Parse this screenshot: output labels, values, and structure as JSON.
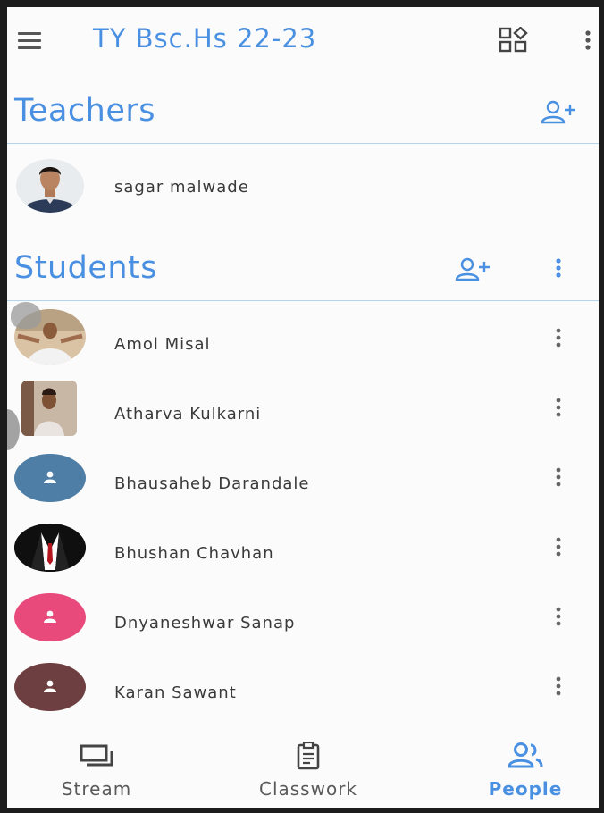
{
  "app_bar": {
    "class_name": "TY Bsc.Hs 22-23",
    "menu_icon": "hamburger-menu-icon",
    "apps_icon": "apps-grid-icon",
    "more_icon": "more-vert-icon"
  },
  "teachers": {
    "heading": "Teachers",
    "add_icon": "person-add-icon",
    "items": [
      {
        "name": "sagar malwade",
        "avatar": "photo"
      }
    ]
  },
  "students": {
    "heading": "Students",
    "add_icon": "person-add-icon",
    "more_icon": "more-vert-icon",
    "items": [
      {
        "name": "Amol Misal",
        "avatar": "photo"
      },
      {
        "name": "Atharva Kulkarni",
        "avatar": "photo"
      },
      {
        "name": "Bhausaheb Darandale",
        "avatar": "default",
        "color": "#4e7ea6"
      },
      {
        "name": "Bhushan Chavhan",
        "avatar": "photo"
      },
      {
        "name": "Dnyaneshwar Sanap",
        "avatar": "default",
        "color": "#e84a7c"
      },
      {
        "name": "Karan Sawant",
        "avatar": "default",
        "color": "#6d3f40"
      }
    ]
  },
  "bottom_nav": {
    "items": [
      {
        "label": "Stream",
        "icon": "stream-icon",
        "active": false
      },
      {
        "label": "Classwork",
        "icon": "classwork-icon",
        "active": false
      },
      {
        "label": "People",
        "icon": "people-icon",
        "active": true
      }
    ]
  },
  "colors": {
    "accent": "#4a90e2",
    "divider": "#b6d4ec",
    "text": "#3a3a3a"
  }
}
